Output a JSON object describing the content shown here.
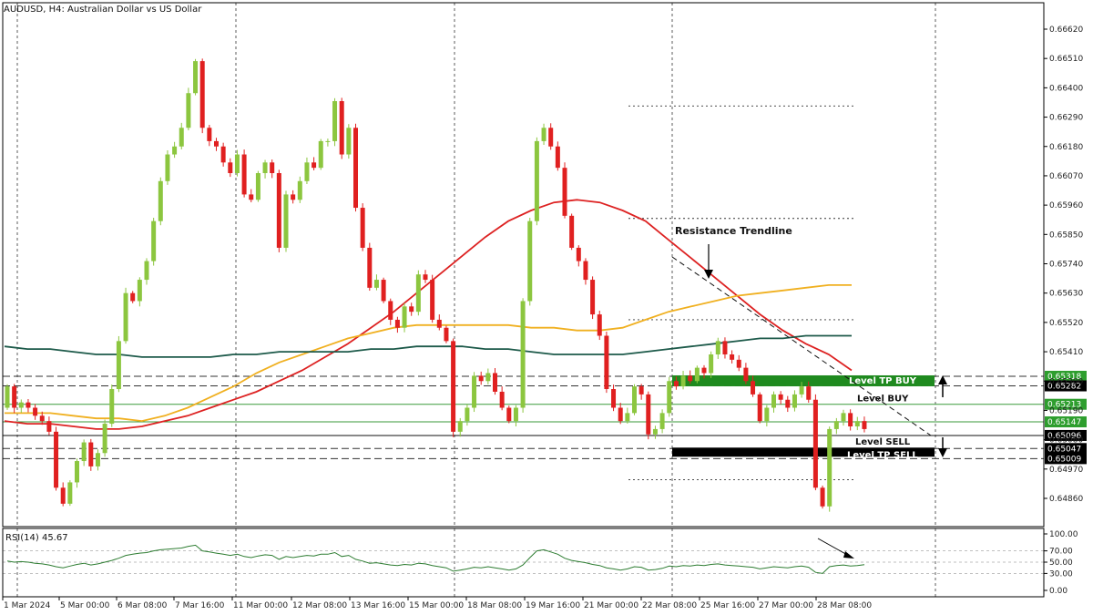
{
  "chart_data": {
    "type": "candlestick",
    "title": "AUDUSD, H4:  Australian Dollar vs US Dollar",
    "y_ticks": [
      "0.66620",
      "0.66510",
      "0.66400",
      "0.66290",
      "0.66180",
      "0.66070",
      "0.65960",
      "0.65850",
      "0.65740",
      "0.65630",
      "0.65520",
      "0.65410",
      "0.65300",
      "0.65190",
      "0.65080",
      "0.64970",
      "0.64860"
    ],
    "ylim": [
      0.6478,
      0.667
    ],
    "x_ticks": [
      "1 Mar 2024",
      "5 Mar 00:00",
      "6 Mar 08:00",
      "7 Mar 16:00",
      "11 Mar 00:00",
      "12 Mar 08:00",
      "13 Mar 16:00",
      "15 Mar 00:00",
      "18 Mar 08:00",
      "19 Mar 16:00",
      "21 Mar 00:00",
      "22 Mar 08:00",
      "25 Mar 16:00",
      "27 Mar 00:00",
      "28 Mar 08:00"
    ],
    "closes": [
      0.6528,
      0.652,
      0.6522,
      0.652,
      0.6517,
      0.6515,
      0.6511,
      0.649,
      0.6484,
      0.6492,
      0.65,
      0.6507,
      0.6498,
      0.6503,
      0.6514,
      0.6527,
      0.6545,
      0.6563,
      0.656,
      0.6568,
      0.6575,
      0.659,
      0.6605,
      0.6615,
      0.6618,
      0.6625,
      0.6638,
      0.665,
      0.6625,
      0.662,
      0.6618,
      0.6612,
      0.6608,
      0.6615,
      0.66,
      0.6598,
      0.6608,
      0.6612,
      0.6608,
      0.658,
      0.66,
      0.6598,
      0.6605,
      0.6612,
      0.661,
      0.662,
      0.662,
      0.6635,
      0.6615,
      0.6625,
      0.6595,
      0.658,
      0.6565,
      0.6568,
      0.656,
      0.6553,
      0.655,
      0.6558,
      0.6556,
      0.657,
      0.6568,
      0.6553,
      0.655,
      0.6545,
      0.6511,
      0.6515,
      0.652,
      0.6532,
      0.653,
      0.6533,
      0.6526,
      0.652,
      0.6515,
      0.652,
      0.656,
      0.659,
      0.662,
      0.6625,
      0.6618,
      0.661,
      0.6592,
      0.658,
      0.6575,
      0.6568,
      0.6555,
      0.6547,
      0.6527,
      0.652,
      0.6515,
      0.6518,
      0.6528,
      0.6525,
      0.651,
      0.6512,
      0.6518,
      0.653,
      0.6528,
      0.6532,
      0.653,
      0.6535,
      0.6533,
      0.654,
      0.6545,
      0.654,
      0.6538,
      0.6535,
      0.653,
      0.6525,
      0.6515,
      0.652,
      0.6525,
      0.6523,
      0.652,
      0.6525,
      0.6528,
      0.6523,
      0.649,
      0.6483,
      0.6512,
      0.6515,
      0.6518,
      0.6513,
      0.6515,
      0.6512
    ],
    "series": [
      {
        "color": "#dd2222",
        "values": [
          0.6515,
          0.6514,
          0.6514,
          0.6513,
          0.6512,
          0.6512,
          0.6513,
          0.6515,
          0.6517,
          0.652,
          0.6523,
          0.6526,
          0.653,
          0.6534,
          0.6539,
          0.6544,
          0.655,
          0.6556,
          0.6563,
          0.657,
          0.6577,
          0.6584,
          0.659,
          0.6594,
          0.6597,
          0.6598,
          0.6597,
          0.6594,
          0.659,
          0.6583,
          0.6576,
          0.6569,
          0.6562,
          0.6555,
          0.6549,
          0.6544,
          0.654,
          0.6534
        ]
      },
      {
        "color": "#f0b020",
        "values": [
          0.6518,
          0.6518,
          0.6518,
          0.6517,
          0.6516,
          0.6516,
          0.6515,
          0.6517,
          0.652,
          0.6524,
          0.6528,
          0.6533,
          0.6537,
          0.654,
          0.6543,
          0.6546,
          0.6548,
          0.655,
          0.6551,
          0.6551,
          0.6551,
          0.6551,
          0.6551,
          0.655,
          0.655,
          0.6549,
          0.6549,
          0.655,
          0.6553,
          0.6556,
          0.6558,
          0.656,
          0.6562,
          0.6563,
          0.6564,
          0.6565,
          0.6566,
          0.6566
        ]
      },
      {
        "color": "#1d5a4a",
        "values": [
          0.6543,
          0.6542,
          0.6542,
          0.6541,
          0.654,
          0.654,
          0.6539,
          0.6539,
          0.6539,
          0.6539,
          0.654,
          0.654,
          0.6541,
          0.6541,
          0.6541,
          0.6541,
          0.6542,
          0.6542,
          0.6543,
          0.6543,
          0.6543,
          0.6542,
          0.6542,
          0.6541,
          0.654,
          0.654,
          0.654,
          0.654,
          0.6541,
          0.6542,
          0.6543,
          0.6544,
          0.6545,
          0.6546,
          0.6546,
          0.6547,
          0.6547,
          0.6547
        ]
      }
    ],
    "levels": [
      {
        "value": 0.65318,
        "label": "Level TP BUY",
        "tag": "0.65318"
      },
      {
        "value": 0.65282,
        "tag": "0.65282"
      },
      {
        "value": 0.65213,
        "label": "Level BUY",
        "tag": "0.65213"
      },
      {
        "value": 0.65147,
        "tag": "0.65147"
      },
      {
        "value": 0.65096,
        "label": "Level SELL",
        "tag": "0.65096"
      },
      {
        "value": 0.65047,
        "tag": "0.65047"
      },
      {
        "value": 0.65009,
        "label": "Level TP SELL",
        "tag": "0.65009"
      }
    ],
    "annotation": "Resistance Trendline",
    "rsi": {
      "label": "RSI(14) 45.67",
      "y_ticks": [
        "100.00",
        "70.00",
        "50.00",
        "30.00",
        "0.00"
      ],
      "ylim": [
        0,
        100
      ],
      "values": [
        52,
        50,
        51,
        50,
        48,
        47,
        45,
        42,
        40,
        43,
        46,
        48,
        45,
        47,
        50,
        53,
        57,
        62,
        64,
        66,
        67,
        70,
        72,
        73,
        74,
        75,
        78,
        80,
        70,
        68,
        66,
        64,
        62,
        64,
        60,
        58,
        61,
        63,
        62,
        55,
        60,
        58,
        60,
        62,
        61,
        64,
        64,
        67,
        60,
        62,
        55,
        52,
        48,
        49,
        47,
        45,
        44,
        46,
        45,
        48,
        47,
        44,
        42,
        40,
        34,
        36,
        38,
        41,
        40,
        42,
        40,
        38,
        36,
        38,
        45,
        58,
        70,
        72,
        68,
        64,
        57,
        53,
        51,
        49,
        46,
        44,
        40,
        38,
        36,
        38,
        42,
        41,
        36,
        37,
        39,
        43,
        42,
        44,
        43,
        45,
        44,
        46,
        47,
        45,
        44,
        43,
        42,
        41,
        38,
        40,
        42,
        41,
        40,
        42,
        43,
        41,
        32,
        30,
        42,
        44,
        45,
        43,
        44,
        45.67
      ]
    }
  }
}
